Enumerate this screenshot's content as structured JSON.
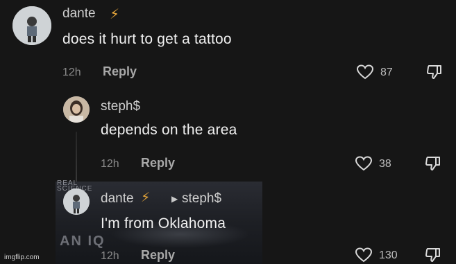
{
  "comments": [
    {
      "username": "dante",
      "verified_icon": "lightning-icon",
      "text": "does it hurt to get a tattoo",
      "time": "12h",
      "reply_label": "Reply",
      "likes": "87"
    },
    {
      "username": "steph$",
      "text": "depends on the area",
      "time": "12h",
      "reply_label": "Reply",
      "likes": "38"
    },
    {
      "username": "dante",
      "verified_icon": "lightning-icon",
      "reply_to": "steph$",
      "text": "I'm from Oklahoma",
      "time": "12h",
      "reply_label": "Reply",
      "likes": "130"
    }
  ],
  "meme_overlay": {
    "small_text_1": "REAL",
    "small_text_2": "SCIENCE",
    "big_text": "AN IQ"
  },
  "watermark": "imgflip.com",
  "colors": {
    "background": "#161616",
    "lightning": "#e0a23a"
  }
}
